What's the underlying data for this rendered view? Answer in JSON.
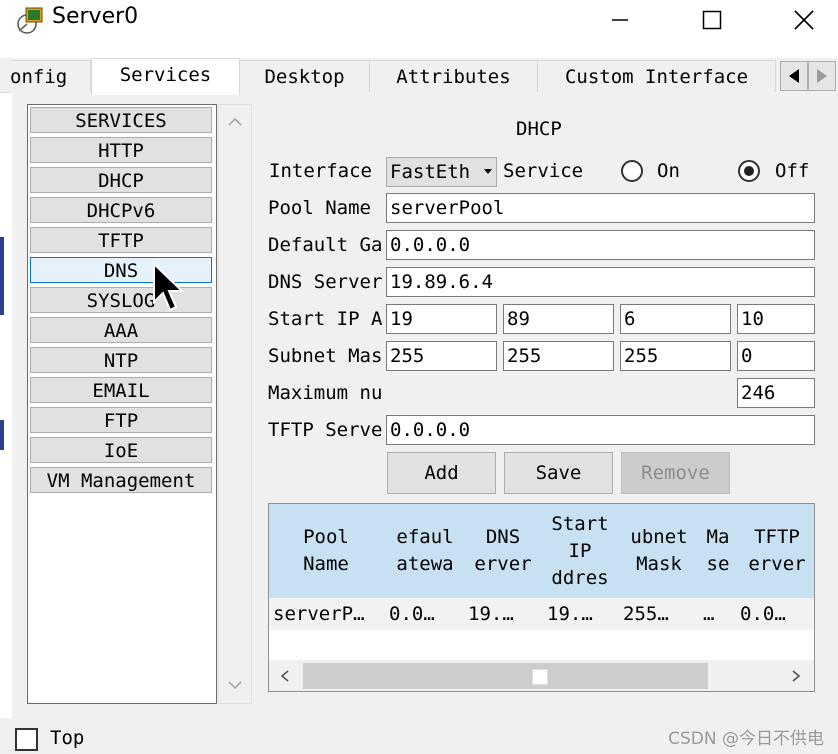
{
  "window": {
    "title": "Server0",
    "minimize_icon": "minimize-icon",
    "maximize_icon": "maximize-icon",
    "close_icon": "close-icon"
  },
  "tabs": [
    {
      "label": "onfig",
      "active": false
    },
    {
      "label": "Services",
      "active": true
    },
    {
      "label": "Desktop",
      "active": false
    },
    {
      "label": "Attributes",
      "active": false
    },
    {
      "label": "Custom Interface",
      "active": false
    }
  ],
  "services": [
    {
      "label": "SERVICES"
    },
    {
      "label": "HTTP"
    },
    {
      "label": "DHCP"
    },
    {
      "label": "DHCPv6"
    },
    {
      "label": "TFTP"
    },
    {
      "label": "DNS",
      "selected": true
    },
    {
      "label": "SYSLOG"
    },
    {
      "label": "AAA"
    },
    {
      "label": "NTP"
    },
    {
      "label": "EMAIL"
    },
    {
      "label": "FTP"
    },
    {
      "label": "IoE"
    },
    {
      "label": "VM Management"
    }
  ],
  "dhcp": {
    "title": "DHCP",
    "interface_label": "Interface",
    "interface_value": "FastEth",
    "service_label": "Service",
    "on_label": "On",
    "off_label": "Off",
    "service_state": "Off",
    "pool_name_label": "Pool Name",
    "pool_name_value": "serverPool",
    "default_gateway_label": "Default Ga",
    "default_gateway_value": "0.0.0.0",
    "dns_server_label": "DNS Server",
    "dns_server_value": "19.89.6.4",
    "start_ip_label": "Start IP A",
    "start_ip": [
      "19",
      "89",
      "6",
      "10"
    ],
    "subnet_mask_label": "Subnet Mas",
    "subnet_mask": [
      "255",
      "255",
      "255",
      "0"
    ],
    "max_users_label": "Maximum nu",
    "max_users_value": "246",
    "tftp_server_label": "TFTP Serve",
    "tftp_server_value": "0.0.0.0",
    "buttons": {
      "add": "Add",
      "save": "Save",
      "remove": "Remove"
    }
  },
  "pool_table": {
    "headers": [
      [
        "Pool",
        "Name"
      ],
      [
        "efaul",
        "atewa"
      ],
      [
        "DNS",
        "erver"
      ],
      [
        "Start",
        "IP",
        "ddres"
      ],
      [
        "ubnet",
        "Mask"
      ],
      [
        "Ma",
        "se"
      ],
      [
        "TFTP",
        "erver"
      ]
    ],
    "row": [
      "serverP…",
      "0.0…",
      "19.…",
      "19.…",
      "255…",
      "…",
      "0.0…"
    ]
  },
  "bottom": {
    "top_label": "Top",
    "top_checked": false,
    "watermark": "CSDN @今日不供电"
  },
  "colors": {
    "table_header": "#c7e1f3",
    "selected_item_border": "#0078d7",
    "panel_bg": "#f0f0f0"
  }
}
